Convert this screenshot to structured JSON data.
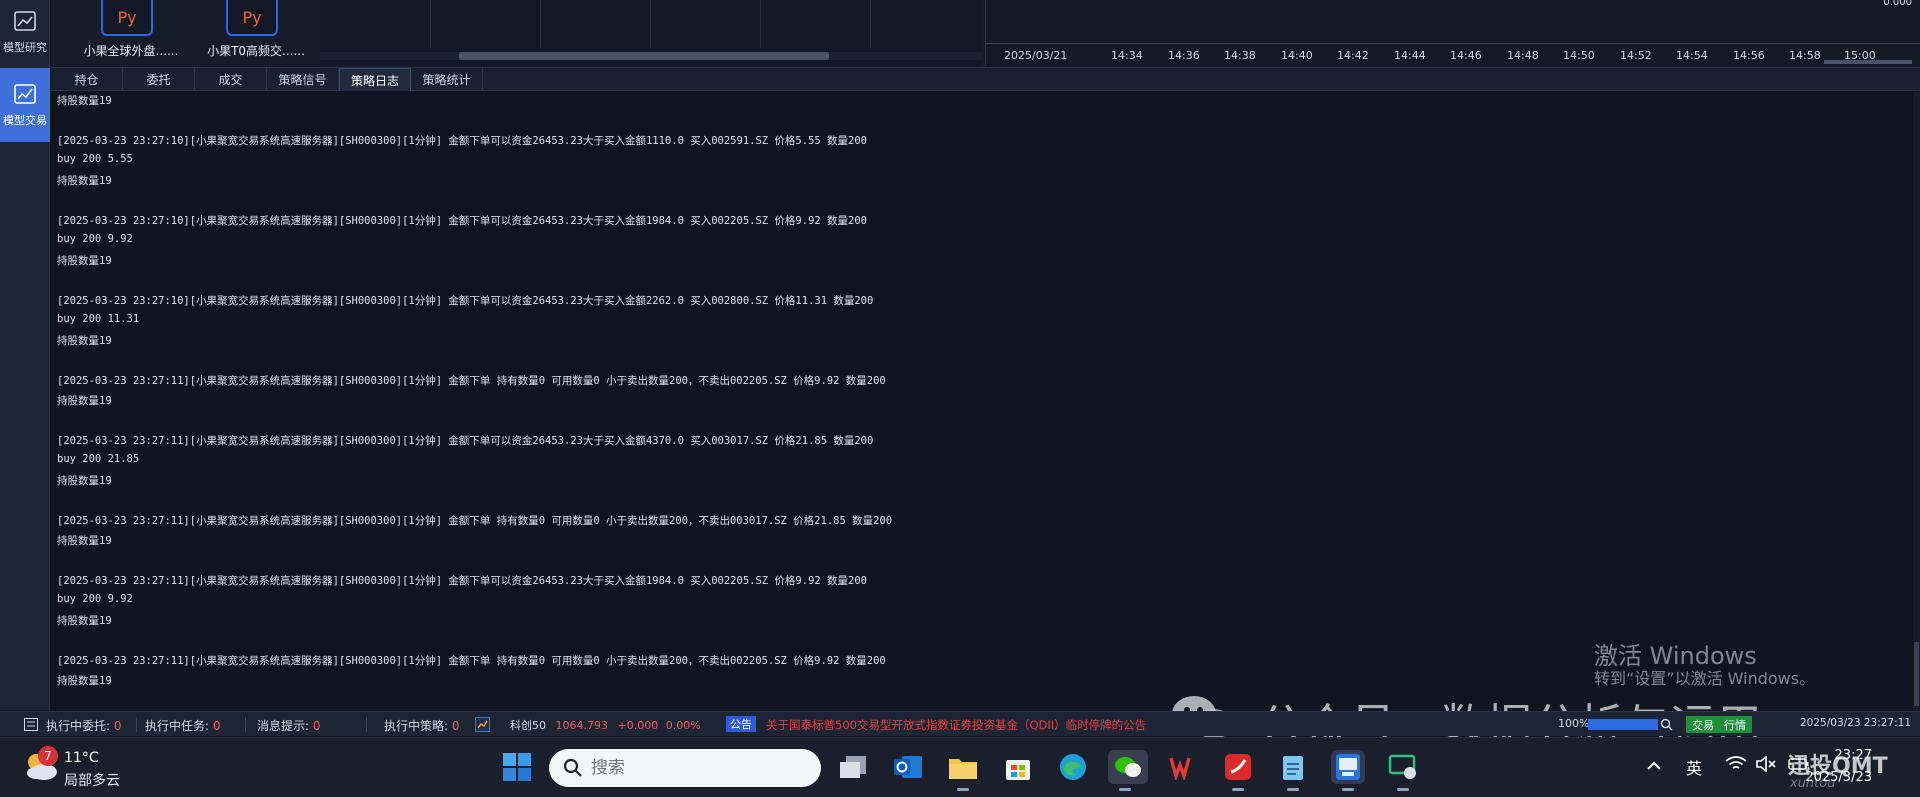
{
  "left_nav": {
    "items": [
      {
        "label": "模型研究",
        "icon": "chart-doc-icon",
        "active": false
      },
      {
        "label": "模型交易",
        "icon": "trend-chart-icon",
        "active": true
      }
    ]
  },
  "strategies": [
    {
      "badge": "Py",
      "name": "小果全球外盘......"
    },
    {
      "badge": "Py",
      "name": "小果T0高频交......"
    }
  ],
  "chart": {
    "date": "2025/03/21",
    "times": [
      "14:34",
      "14:36",
      "14:38",
      "14:40",
      "14:42",
      "14:44",
      "14:46",
      "14:48",
      "14:50",
      "14:52",
      "14:54",
      "14:56",
      "14:58",
      "15:00"
    ],
    "y_value": "0.000"
  },
  "tabs": [
    {
      "label": "持仓",
      "active": false
    },
    {
      "label": "委托",
      "active": false
    },
    {
      "label": "成交",
      "active": false
    },
    {
      "label": "策略信号",
      "active": false
    },
    {
      "label": "策略日志",
      "active": true
    },
    {
      "label": "策略统计",
      "active": false
    }
  ],
  "log_lines": [
    "持股数量19",
    "",
    "[2025-03-23 23:27:10][小果聚宽交易系统高速服务器][SH000300][1分钟] 金额下单可以资金26453.23大于买入金额1110.0 买入002591.SZ 价格5.55 数量200",
    "buy 200 5.55",
    "持股数量19",
    "",
    "[2025-03-23 23:27:10][小果聚宽交易系统高速服务器][SH000300][1分钟] 金额下单可以资金26453.23大于买入金额1984.0 买入002205.SZ 价格9.92 数量200",
    "buy 200 9.92",
    "持股数量19",
    "",
    "[2025-03-23 23:27:10][小果聚宽交易系统高速服务器][SH000300][1分钟] 金额下单可以资金26453.23大于买入金额2262.0 买入002800.SZ 价格11.31 数量200",
    "buy 200 11.31",
    "持股数量19",
    "",
    "[2025-03-23 23:27:11][小果聚宽交易系统高速服务器][SH000300][1分钟] 金额下单 持有数量0 可用数量0 小于卖出数量200，不卖出002205.SZ 价格9.92 数量200",
    "持股数量19",
    "",
    "[2025-03-23 23:27:11][小果聚宽交易系统高速服务器][SH000300][1分钟] 金额下单可以资金26453.23大于买入金额4370.0 买入003017.SZ 价格21.85 数量200",
    "buy 200 21.85",
    "持股数量19",
    "",
    "[2025-03-23 23:27:11][小果聚宽交易系统高速服务器][SH000300][1分钟] 金额下单 持有数量0 可用数量0 小于卖出数量200，不卖出003017.SZ 价格21.85 数量200",
    "持股数量19",
    "",
    "[2025-03-23 23:27:11][小果聚宽交易系统高速服务器][SH000300][1分钟] 金额下单可以资金26453.23大于买入金额1984.0 买入002205.SZ 价格9.92 数量200",
    "buy 200 9.92",
    "持股数量19",
    "",
    "[2025-03-23 23:27:11][小果聚宽交易系统高速服务器][SH000300][1分钟] 金额下单 持有数量0 可用数量0 小于卖出数量200，不卖出002205.SZ 价格9.92 数量200",
    "持股数量19"
  ],
  "activation": {
    "line1": "激活 Windows",
    "line2": "转到“设置”以激活 Windows。"
  },
  "watermark": {
    "text": "公众号 · 数据分析与运用",
    "brand": "迅投QMT",
    "brand_sub": "xuntou"
  },
  "status_bar": {
    "entrust_label": "执行中委托:",
    "entrust_count": "0",
    "task_label": "执行中任务:",
    "task_count": "0",
    "msg_label": "消息提示:",
    "msg_count": "0",
    "strategy_label": "执行中策略:",
    "strategy_count": "0",
    "index_name": "科创50",
    "index_value": "1064.793",
    "index_change": "+0.000",
    "index_pct": "0.00%",
    "announce_badge": "公告",
    "announce_text": "关于国泰标普500交易型开放式指数证券投资基金（QDII）临时停牌的公告",
    "progress_label": "100%",
    "progress_value": 1.0,
    "trade_pill": "交易",
    "quote_pill": "行情",
    "datetime": "2025/03/23 23:27:11"
  },
  "taskbar": {
    "weather_badge": "7",
    "temperature": "11°C",
    "condition": "局部多云",
    "search_placeholder": "搜索",
    "ime": "英",
    "time": "23:27",
    "date": "2025/3/23"
  },
  "colors": {
    "accent": "#3f6fd9",
    "log_bg": "#0f1420",
    "alert_red": "#f25a5a",
    "python_orange": "#f0642f"
  }
}
